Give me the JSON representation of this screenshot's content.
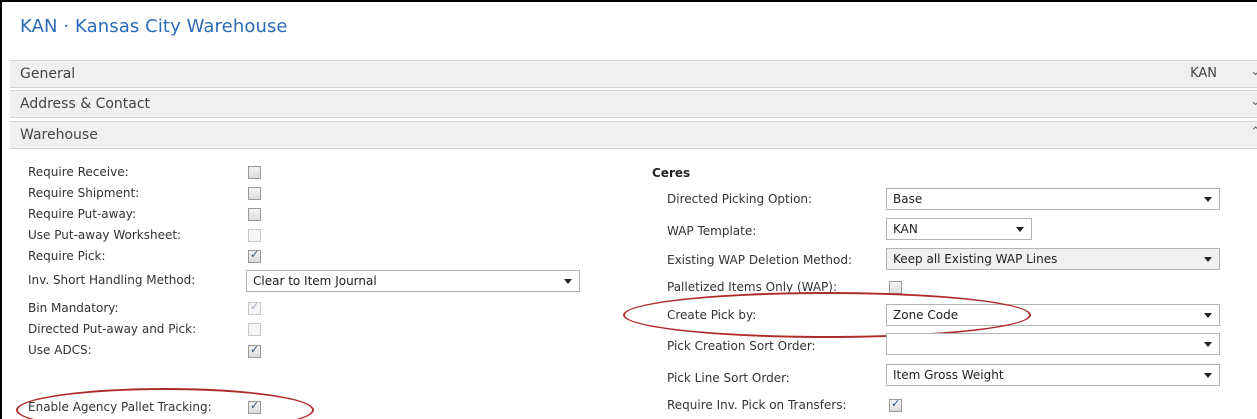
{
  "page": {
    "title": "KAN · Kansas City Warehouse"
  },
  "fasttabs": {
    "general": {
      "label": "General",
      "summary": "KAN",
      "state": "collapsed"
    },
    "address": {
      "label": "Address & Contact",
      "state": "collapsed"
    },
    "warehouse": {
      "label": "Warehouse",
      "state": "expanded"
    }
  },
  "left_fields": {
    "require_receive": {
      "label": "Require Receive:",
      "checked": false
    },
    "require_shipment": {
      "label": "Require Shipment:",
      "checked": false
    },
    "require_putaway": {
      "label": "Require Put-away:",
      "checked": false
    },
    "use_putaway_worksheet": {
      "label": "Use Put-away Worksheet:",
      "checked": false,
      "disabled": true
    },
    "require_pick": {
      "label": "Require Pick:",
      "checked": true
    },
    "inv_short_handling": {
      "label": "Inv. Short Handling Method:",
      "value": "Clear to Item Journal"
    },
    "bin_mandatory": {
      "label": "Bin Mandatory:",
      "checked": true,
      "disabled": true
    },
    "directed_putaway_pick": {
      "label": "Directed Put-away and Pick:",
      "checked": false,
      "disabled": true
    },
    "use_adcs": {
      "label": "Use ADCS:",
      "checked": true
    },
    "enable_agency_pallet": {
      "label": "Enable Agency Pallet Tracking:",
      "checked": true
    }
  },
  "ceres": {
    "heading": "Ceres",
    "directed_picking_option": {
      "label": "Directed Picking Option:",
      "value": "Base"
    },
    "wap_template": {
      "label": "WAP Template:",
      "value": "KAN"
    },
    "existing_wap_deletion": {
      "label": "Existing WAP Deletion Method:",
      "value": "Keep all Existing WAP Lines"
    },
    "palletized_items_only": {
      "label": "Palletized Items Only (WAP):",
      "checked": false
    },
    "create_pick_by": {
      "label": "Create Pick by:",
      "value": "Zone Code"
    },
    "pick_creation_sort_order": {
      "label": "Pick Creation Sort Order:",
      "value": ""
    },
    "pick_line_sort_order": {
      "label": "Pick Line Sort Order:",
      "value": "Item Gross Weight"
    },
    "require_inv_pick_transfers": {
      "label": "Require Inv. Pick on Transfers:",
      "checked": true
    }
  },
  "glyphs": {
    "check": "✓",
    "chevron_down": "⌄",
    "chevron_up": "⌃"
  },
  "colors": {
    "title": "#2b6cb8",
    "annotation": "#b02a2a",
    "fasttab_bg": "#f0f0f0"
  }
}
